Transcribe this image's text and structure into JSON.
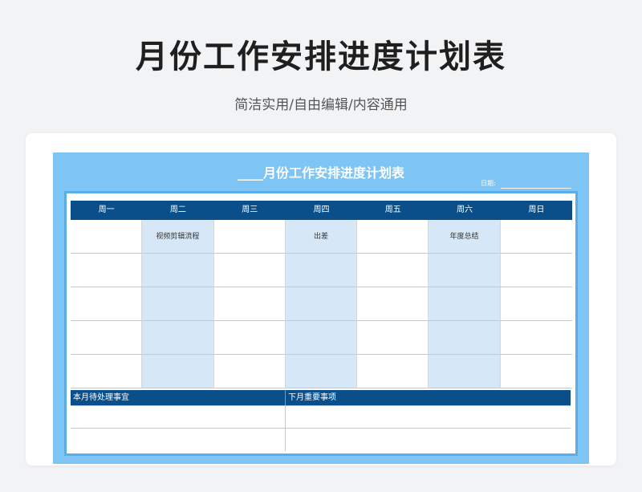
{
  "page": {
    "title": "月份工作安排进度计划表",
    "subtitle": "简洁实用/自由编辑/内容通用"
  },
  "sheet": {
    "title": "____月份工作安排进度计划表",
    "date_label": "日期:",
    "weekdays": [
      "周一",
      "周二",
      "周三",
      "周四",
      "周五",
      "周六",
      "周日"
    ],
    "rows": [
      [
        "",
        "视频剪辑流程",
        "",
        "出差",
        "",
        "年度总结",
        ""
      ],
      [
        "",
        "",
        "",
        "",
        "",
        "",
        ""
      ],
      [
        "",
        "",
        "",
        "",
        "",
        "",
        ""
      ],
      [
        "",
        "",
        "",
        "",
        "",
        "",
        ""
      ],
      [
        "",
        "",
        "",
        "",
        "",
        "",
        ""
      ]
    ],
    "todo_headers": [
      "本月待处理事宜",
      "下月重要事项"
    ]
  },
  "colors": {
    "sheet_bg": "#7ec4f5",
    "header_bg": "#0b4f8a",
    "shaded_column": "#d6e8f8"
  }
}
